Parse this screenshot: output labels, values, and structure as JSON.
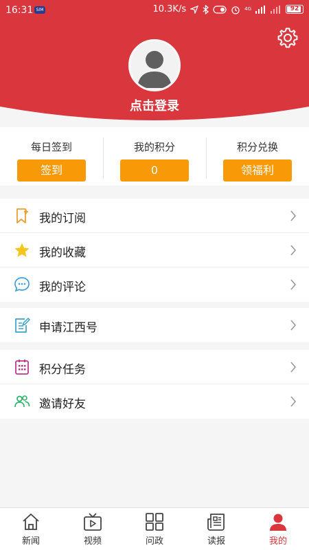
{
  "status": {
    "time": "16:31",
    "chip": "SIM",
    "speed": "10.3K/s",
    "net_label": "4G",
    "battery": "92"
  },
  "colors": {
    "header_red": "#d9363e",
    "accent_orange": "#f89a07",
    "active_red": "#d9363e"
  },
  "profile": {
    "login_text": "点击登录"
  },
  "stats": [
    {
      "label": "每日签到",
      "button": "签到"
    },
    {
      "label": "我的积分",
      "button": "0"
    },
    {
      "label": "积分兑换",
      "button": "领福利"
    }
  ],
  "menu": {
    "group1": [
      {
        "label": "我的订阅",
        "icon": "bookmark-plus-icon"
      },
      {
        "label": "我的收藏",
        "icon": "star-icon"
      },
      {
        "label": "我的评论",
        "icon": "comment-icon"
      }
    ],
    "group2": [
      {
        "label": "申请江西号",
        "icon": "edit-document-icon"
      }
    ],
    "group3": [
      {
        "label": "积分任务",
        "icon": "calendar-icon"
      },
      {
        "label": "邀请好友",
        "icon": "friends-icon"
      }
    ]
  },
  "nav": [
    {
      "label": "新闻",
      "icon": "home-icon"
    },
    {
      "label": "视频",
      "icon": "tv-icon"
    },
    {
      "label": "问政",
      "icon": "grid-icon"
    },
    {
      "label": "读报",
      "icon": "newspaper-icon"
    },
    {
      "label": "我的",
      "icon": "person-icon",
      "active": true
    }
  ]
}
